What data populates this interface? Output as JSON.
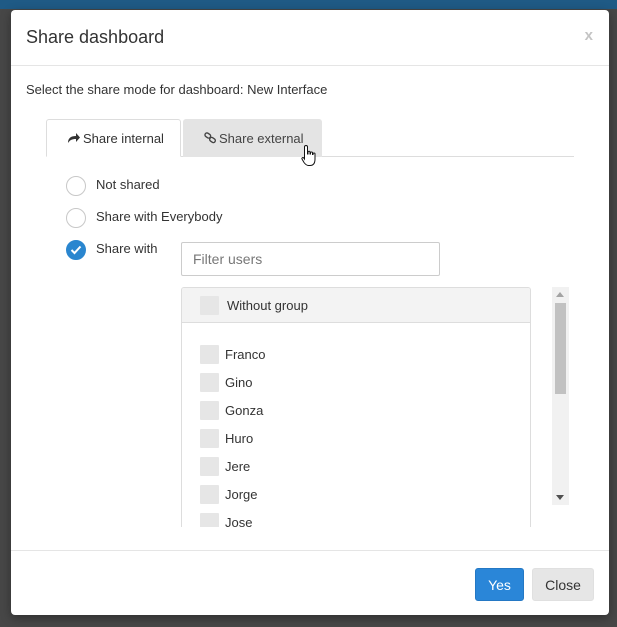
{
  "modal": {
    "title": "Share dashboard",
    "close_label": "x",
    "intro": "Select the share mode for dashboard: New Interface"
  },
  "tabs": [
    {
      "label": "Share internal",
      "icon": "share-arrow-icon",
      "active": true
    },
    {
      "label": "Share external",
      "icon": "link-icon",
      "active": false
    }
  ],
  "share_modes": [
    {
      "label": "Not shared",
      "checked": false
    },
    {
      "label": "Share with Everybody",
      "checked": false
    },
    {
      "label": "Share with",
      "checked": true
    }
  ],
  "filter": {
    "placeholder": "Filter users",
    "value": ""
  },
  "group": {
    "label": "Without group",
    "checked": false
  },
  "users": [
    {
      "name": "Franco",
      "checked": false
    },
    {
      "name": "Gino",
      "checked": false
    },
    {
      "name": "Gonza",
      "checked": false
    },
    {
      "name": "Huro",
      "checked": false
    },
    {
      "name": "Jere",
      "checked": false
    },
    {
      "name": "Jorge",
      "checked": false
    },
    {
      "name": "Jose",
      "checked": false
    }
  ],
  "footer": {
    "yes_label": "Yes",
    "close_label": "Close"
  },
  "colors": {
    "primary": "#2a86d8",
    "radio_checked": "#2a86cf",
    "tab_inactive": "#e4e4e4"
  }
}
